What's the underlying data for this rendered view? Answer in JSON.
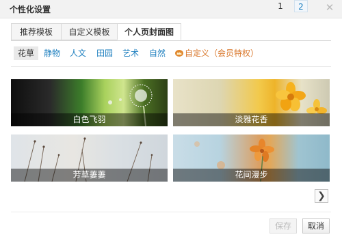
{
  "dialog": {
    "title": "个性化设置",
    "close_glyph": "✕"
  },
  "tabs": [
    {
      "label": "推荐模板",
      "active": false
    },
    {
      "label": "自定义模板",
      "active": false
    },
    {
      "label": "个人页封面图",
      "active": true
    }
  ],
  "categories": [
    {
      "label": "花草",
      "active": true
    },
    {
      "label": "静物",
      "active": false
    },
    {
      "label": "人文",
      "active": false
    },
    {
      "label": "田园",
      "active": false
    },
    {
      "label": "艺术",
      "active": false
    },
    {
      "label": "自然",
      "active": false
    },
    {
      "label": "自定义（会员特权）",
      "active": false,
      "icon": "vip-crown-icon",
      "color": "#d9772b"
    }
  ],
  "covers": [
    {
      "caption": "白色飞羽"
    },
    {
      "caption": "淡雅花香"
    },
    {
      "caption": "芳草萋萋"
    },
    {
      "caption": "花间漫步"
    }
  ],
  "pagination": {
    "pages": [
      "1",
      "2"
    ],
    "current": "2",
    "next_glyph": "❯"
  },
  "buttons": {
    "save": "保存",
    "cancel": "取消"
  },
  "colors": {
    "link": "#1d7fbf",
    "vip": "#d9772b"
  }
}
